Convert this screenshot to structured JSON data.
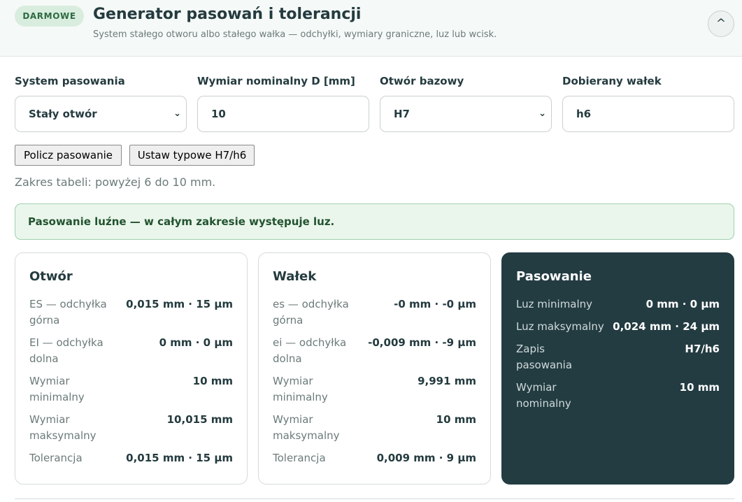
{
  "header": {
    "badge": "DARMOWE",
    "title": "Generator pasowań i tolerancji",
    "subtitle": "System stałego otworu albo stałego wałka — odchyłki, wymiary graniczne, luz lub wcisk.",
    "collapse_label": "^"
  },
  "form": {
    "system": {
      "label": "System pasowania",
      "value": "Stały otwór"
    },
    "nominal": {
      "label": "Wymiar nominalny D [mm]",
      "value": "10"
    },
    "base": {
      "label": "Otwór bazowy",
      "value": "H7"
    },
    "mate": {
      "label": "Dobierany wałek",
      "value": "h6"
    },
    "chevron": "⌄"
  },
  "actions": {
    "calculate": "Policz pasowanie",
    "typical": "Ustaw typowe H7/h6"
  },
  "range_text": "Zakres tabeli: powyżej 6 do 10 mm.",
  "result_banner": "Pasowanie luźne — w całym zakresie występuje luz.",
  "cards": {
    "hole": {
      "title": "Otwór",
      "rows": [
        {
          "label": "ES — odchyłka górna",
          "value": "0,015 mm · 15 μm"
        },
        {
          "label": "EI — odchyłka dolna",
          "value": "0 mm · 0 μm"
        },
        {
          "label": "Wymiar minimalny",
          "value": "10 mm"
        },
        {
          "label": "Wymiar maksymalny",
          "value": "10,015 mm"
        },
        {
          "label": "Tolerancja",
          "value": "0,015 mm · 15 μm"
        }
      ]
    },
    "shaft": {
      "title": "Wałek",
      "rows": [
        {
          "label": "es — odchyłka górna",
          "value": "-0 mm · -0 μm"
        },
        {
          "label": "ei — odchyłka dolna",
          "value": "-0,009 mm · -9 μm"
        },
        {
          "label": "Wymiar minimalny",
          "value": "9,991 mm"
        },
        {
          "label": "Wymiar maksymalny",
          "value": "10 mm"
        },
        {
          "label": "Tolerancja",
          "value": "0,009 mm · 9 μm"
        }
      ]
    },
    "fit": {
      "title": "Pasowanie",
      "rows": [
        {
          "label": "Luz minimalny",
          "value": "0 mm · 0 μm"
        },
        {
          "label": "Luz maksymalny",
          "value": "0,024 mm · 24 μm"
        },
        {
          "label": "Zapis pasowania",
          "value": "H7/h6"
        },
        {
          "label": "Wymiar nominalny",
          "value": "10 mm"
        }
      ]
    }
  },
  "colors": {
    "accent_dark": "#233c42",
    "badge_bg": "#d9eddf",
    "banner_bg": "#eaf6ec",
    "banner_text": "#22532f"
  }
}
